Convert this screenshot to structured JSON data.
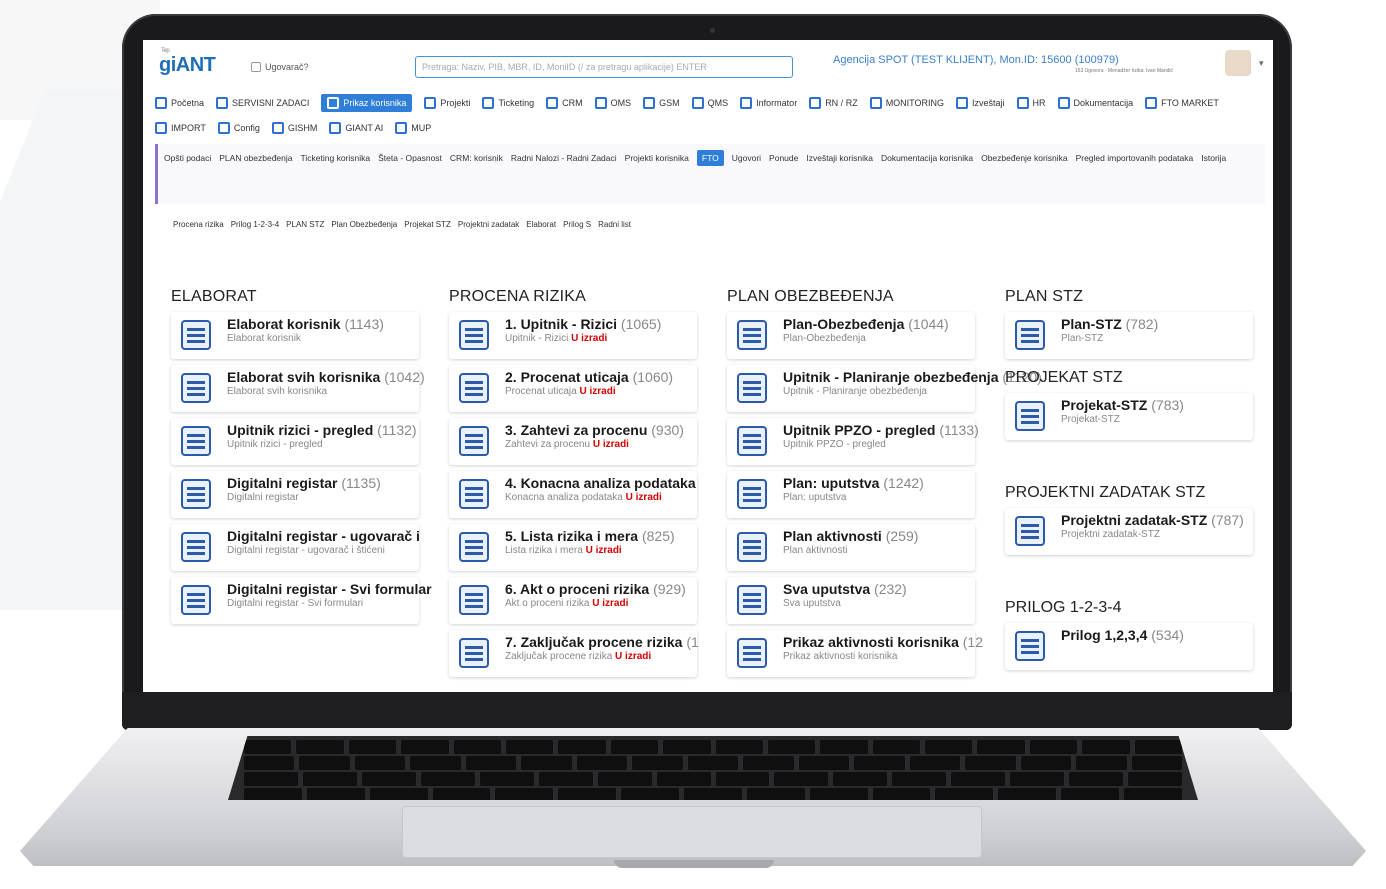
{
  "app": {
    "logo": "giANT",
    "logo_small": "Tep",
    "ugovarac_label": "Ugovarač?",
    "search_placeholder": "Pretraga: Naziv, PIB, MBR, ID, MoniID (/ za pretragu aplikacije) ENTER",
    "agency": "Agencija SPOT (TEST KLIJENT), Mon.ID: 15600 (100979)",
    "agency_sub": "153 Ugovora · Menadžer rizika: Ivan Mandić"
  },
  "menu": [
    {
      "label": "Početna",
      "icon": "menu-icon"
    },
    {
      "label": "SERVISNI ZADACI",
      "icon": "tools-icon"
    },
    {
      "label": "Prikaz korisnika",
      "icon": "users-icon",
      "active": true
    },
    {
      "label": "Projekti",
      "icon": "project-icon"
    },
    {
      "label": "Ticketing",
      "icon": "clock-icon"
    },
    {
      "label": "CRM",
      "icon": "crm-icon"
    },
    {
      "label": "OMS",
      "icon": "oms-icon"
    },
    {
      "label": "GSM",
      "icon": "gsm-icon"
    },
    {
      "label": "QMS",
      "icon": "qms-icon"
    },
    {
      "label": "Informator",
      "icon": "mail-icon"
    },
    {
      "label": "RN / RZ",
      "icon": "rn-icon"
    },
    {
      "label": "MONITORING",
      "icon": "eye-icon"
    },
    {
      "label": "Izveštaji",
      "icon": "report-icon"
    },
    {
      "label": "HR",
      "icon": "person-icon"
    },
    {
      "label": "Dokumentacija",
      "icon": "folder-icon"
    },
    {
      "label": "FTO MARKET",
      "icon": "market-icon"
    },
    {
      "label": "IMPORT",
      "icon": "import-icon"
    },
    {
      "label": "Config",
      "icon": "gear-icon"
    },
    {
      "label": "GISHM",
      "icon": "gishm-icon"
    },
    {
      "label": "GIANT AI",
      "icon": "ai-icon"
    },
    {
      "label": "MUP",
      "icon": "mup-icon"
    }
  ],
  "subtabs": [
    {
      "label": "Opšti podaci"
    },
    {
      "label": "PLAN obezbeđenja"
    },
    {
      "label": "Ticketing korisnika"
    },
    {
      "label": "Šteta - Opasnost"
    },
    {
      "label": "CRM: korisnik"
    },
    {
      "label": "Radni Nalozi - Radni Zadaci"
    },
    {
      "label": "Projekti korisnika"
    },
    {
      "label": "FTO",
      "active": true
    },
    {
      "label": "Ugovori"
    },
    {
      "label": "Ponude"
    },
    {
      "label": "Izveštaji korisnika"
    },
    {
      "label": "Dokumentacija korisnika"
    },
    {
      "label": "Obezbeđenje korisnika"
    },
    {
      "label": "Pregled importovanih podataka"
    },
    {
      "label": "Istorija"
    }
  ],
  "fto_tabs": [
    "Procena rizika",
    "Prilog 1-2-3-4",
    "PLAN STZ",
    "Plan Obezbeđenja",
    "Projekat STZ",
    "Projektni zadatak",
    "Elaborat",
    "Prilog S",
    "Radni list"
  ],
  "sections": {
    "elaborat": {
      "title": "ELABORAT",
      "cards": [
        {
          "title": "Elaborat korisnik",
          "count": "(1143)",
          "sub": "Elaborat korisnik",
          "flag": ""
        },
        {
          "title": "Elaborat svih korisnika",
          "count": "(1042)",
          "sub": "Elaborat svih korisnika",
          "flag": ""
        },
        {
          "title": "Upitnik rizici - pregled",
          "count": "(1132)",
          "sub": "Upitnik rizici - pregled",
          "flag": ""
        },
        {
          "title": "Digitalni registar",
          "count": "(1135)",
          "sub": "Digitalni registar",
          "flag": ""
        },
        {
          "title": "Digitalni registar - ugovarač i",
          "count": "",
          "sub": "Digitalni registar - ugovarač i štićeni",
          "flag": ""
        },
        {
          "title": "Digitalni registar - Svi formular",
          "count": "",
          "sub": "Digitalni registar - Svi formulari",
          "flag": ""
        }
      ]
    },
    "procena": {
      "title": "PROCENA RIZIKA",
      "cards": [
        {
          "title": "1. Upitnik - Rizici",
          "count": "(1065)",
          "sub": "Upitnik - Rizici",
          "flag": "U izradi"
        },
        {
          "title": "2. Procenat uticaja",
          "count": "(1060)",
          "sub": "Procenat uticaja",
          "flag": "U izradi"
        },
        {
          "title": "3. Zahtevi za procenu",
          "count": "(930)",
          "sub": "Zahtevi za procenu",
          "flag": "U izradi"
        },
        {
          "title": "4. Konacna analiza podataka",
          "count": "",
          "sub": "Konacna analiza podataka",
          "flag": "U izradi"
        },
        {
          "title": "5. Lista rizika i mera",
          "count": "(825)",
          "sub": "Lista rizika i mera",
          "flag": "U izradi"
        },
        {
          "title": "6. Akt o proceni rizika",
          "count": "(929)",
          "sub": "Akt o proceni rizika",
          "flag": "U izradi"
        },
        {
          "title": "7. Zaključak procene rizika",
          "count": "(1",
          "sub": "Zaključak procene rizika",
          "flag": "U izradi"
        }
      ]
    },
    "plan_obezbedjenja": {
      "title": "PLAN OBEZBEĐENJA",
      "cards": [
        {
          "title": "Plan-Obezbeđenja",
          "count": "(1044)",
          "sub": "Plan-Obezbeđenja",
          "flag": ""
        },
        {
          "title": "Upitnik - Planiranje obezbeđenja",
          "count": "(1120)",
          "sub": "Upitnik - Planiranje obezbeđenja",
          "flag": ""
        },
        {
          "title": "Upitnik PPZO - pregled",
          "count": "(1133)",
          "sub": "Upitnik PPZO - pregled",
          "flag": ""
        },
        {
          "title": "Plan: uputstva",
          "count": "(1242)",
          "sub": "Plan: uputstva",
          "flag": ""
        },
        {
          "title": "Plan aktivnosti",
          "count": "(259)",
          "sub": "Plan aktivnosti",
          "flag": ""
        },
        {
          "title": "Sva uputstva",
          "count": "(232)",
          "sub": "Sva uputstva",
          "flag": ""
        },
        {
          "title": "Prikaz aktivnosti korisnika",
          "count": "(12",
          "sub": "Prikaz aktivnosti korisnika",
          "flag": ""
        }
      ]
    },
    "plan_stz": {
      "title": "PLAN STZ",
      "cards": [
        {
          "title": "Plan-STZ",
          "count": "(782)",
          "sub": "Plan-STZ",
          "flag": ""
        }
      ]
    },
    "projekat_stz": {
      "title": "PROJEKAT STZ",
      "cards": [
        {
          "title": "Projekat-STZ",
          "count": "(783)",
          "sub": "Projekat-STZ",
          "flag": ""
        }
      ]
    },
    "projektni_zadatak": {
      "title": "PROJEKTNI ZADATAK STZ",
      "cards": [
        {
          "title": "Projektni zadatak-STZ",
          "count": "(787)",
          "sub": "Projektni zadatak-STZ",
          "flag": ""
        }
      ]
    },
    "prilog": {
      "title": "PRILOG 1-2-3-4",
      "cards": [
        {
          "title": "Prilog 1,2,3,4",
          "count": "(534)",
          "sub": "",
          "flag": ""
        }
      ]
    }
  }
}
